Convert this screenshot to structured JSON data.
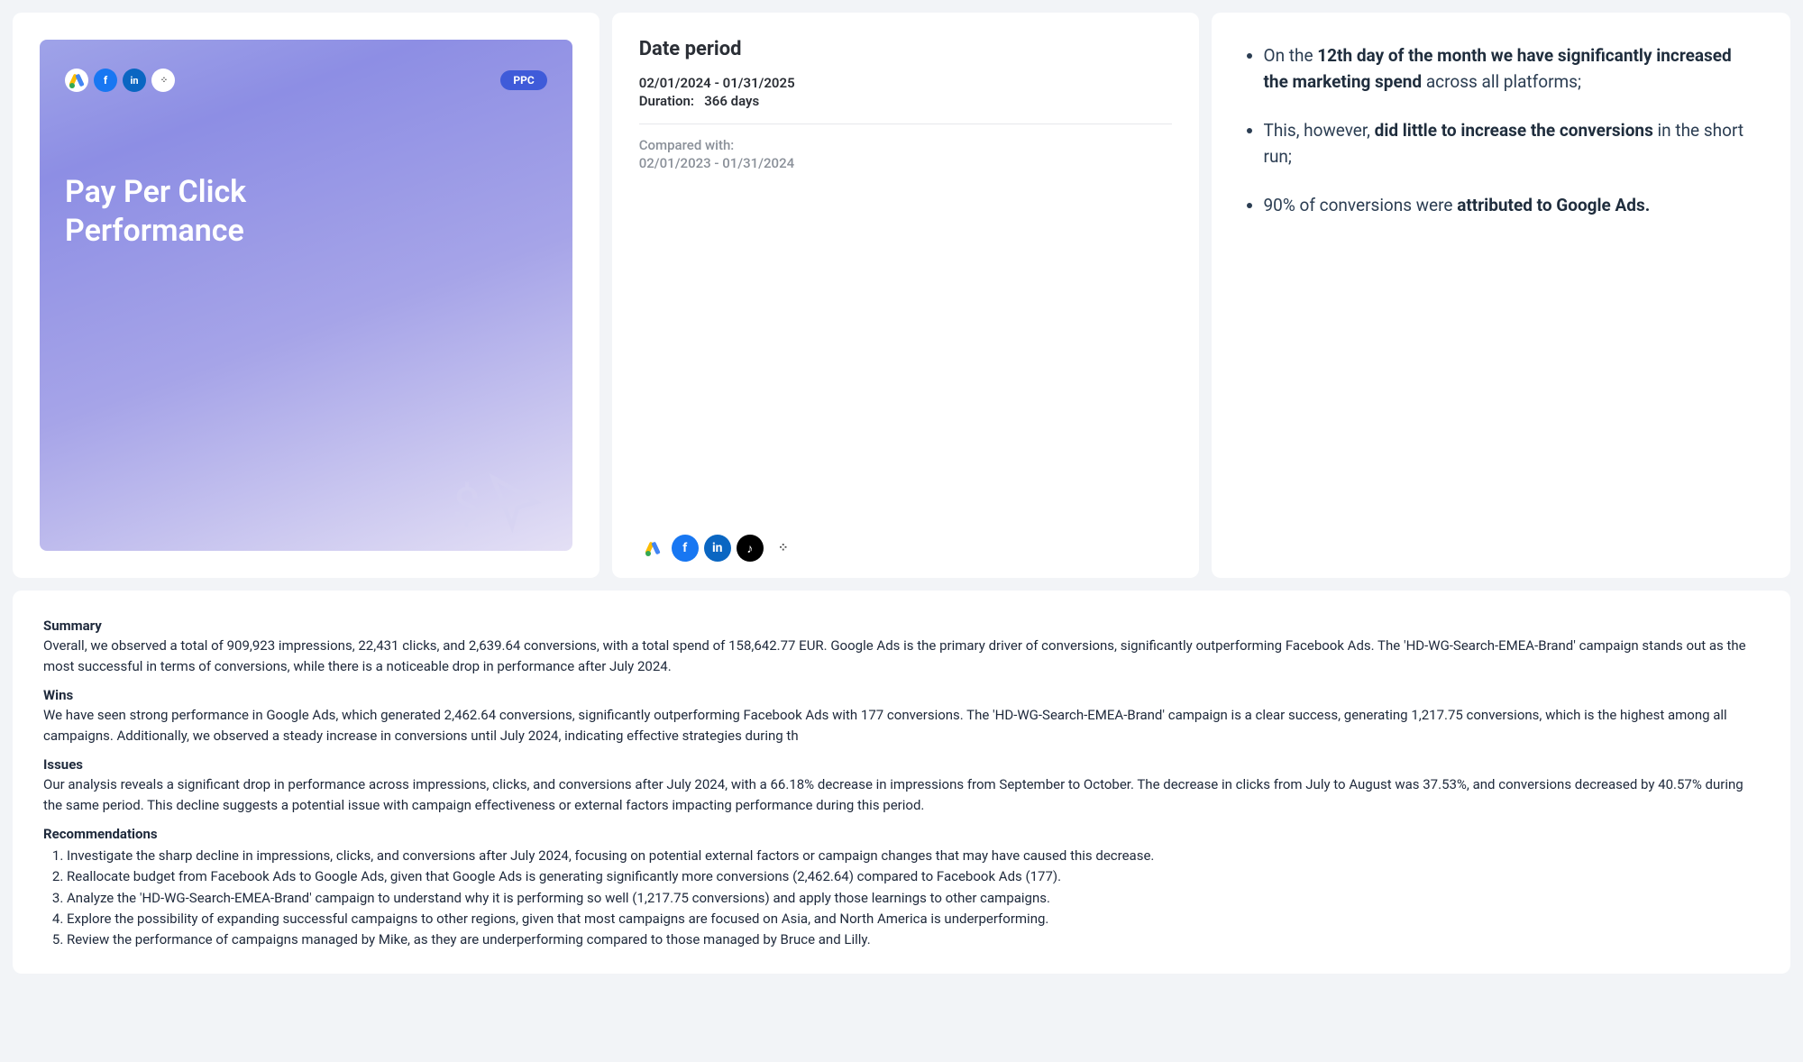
{
  "cover": {
    "badge": "PPC",
    "title_line1": "Pay Per Click",
    "title_line2": "Performance"
  },
  "date_period": {
    "heading": "Date period",
    "range": "02/01/2024 - 01/31/2025",
    "duration_label": "Duration:",
    "duration_value": "366 days",
    "compared_label": "Compared with:",
    "compared_range": "02/01/2023 - 01/31/2024"
  },
  "highlights": {
    "b1_pre": "On the ",
    "b1_bold": "12th day of the month we have significantly increased the marketing spend",
    "b1_post": " across all platforms;",
    "b2_pre": "This, however, ",
    "b2_bold": "did little to increase the conversions",
    "b2_post": " in the short run;",
    "b3_pre": "90% of conversions were ",
    "b3_bold": "attributed to Google Ads."
  },
  "summary": {
    "summary_title": "Summary",
    "summary_body": "Overall, we observed a total of 909,923 impressions, 22,431 clicks, and 2,639.64 conversions, with a total spend of 158,642.77 EUR. Google Ads is the primary driver of conversions, significantly outperforming Facebook Ads. The 'HD-WG-Search-EMEA-Brand' campaign stands out as the most successful in terms of conversions, while there is a noticeable drop in performance after July 2024.",
    "wins_title": "Wins",
    "wins_body": "We have seen strong performance in Google Ads, which generated 2,462.64 conversions, significantly outperforming Facebook Ads with 177 conversions. The 'HD-WG-Search-EMEA-Brand' campaign is a clear success, generating 1,217.75 conversions, which is the highest among all campaigns. Additionally, we observed a steady increase in conversions until July 2024, indicating effective strategies during th",
    "issues_title": "Issues",
    "issues_body": "Our analysis reveals a significant drop in performance across impressions, clicks, and conversions after July 2024, with a 66.18% decrease in impressions from September to October. The decrease in clicks from July to August was 37.53%, and conversions decreased by 40.57% during the same period. This decline suggests a potential issue with campaign effectiveness or external factors impacting performance during this period.",
    "reco_title": "Recommendations",
    "reco": {
      "r1": "Investigate the sharp decline in impressions, clicks, and conversions after July 2024, focusing on potential external factors or campaign changes that may have caused this decrease.",
      "r2": "Reallocate budget from Facebook Ads to Google Ads, given that Google Ads is generating significantly more conversions (2,462.64) compared to Facebook Ads (177).",
      "r3": "Analyze the 'HD-WG-Search-EMEA-Brand' campaign to understand why it is performing so well (1,217.75 conversions) and apply those learnings to other campaigns.",
      "r4": "Explore the possibility of expanding successful campaigns to other regions, given that most campaigns are focused on Asia, and North America is underperforming.",
      "r5": "Review the performance of campaigns managed by Mike, as they are underperforming compared to those managed by Bruce and Lilly."
    }
  }
}
